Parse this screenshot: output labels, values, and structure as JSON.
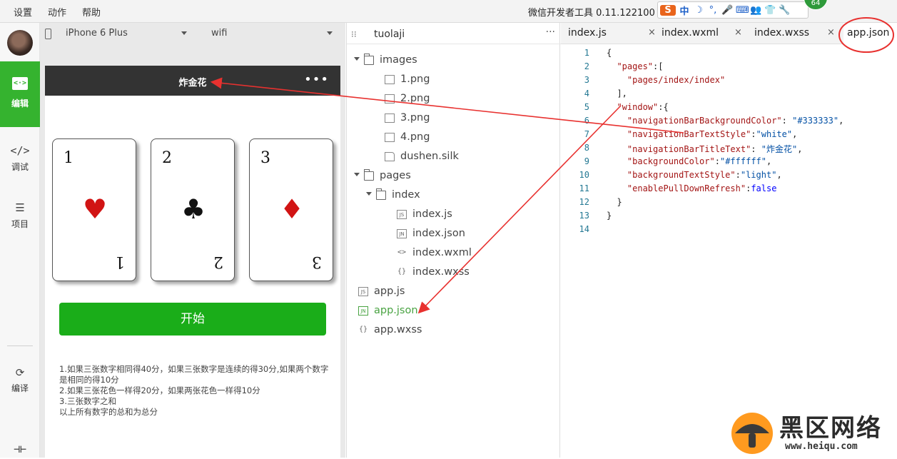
{
  "menubar": {
    "items": [
      "设置",
      "动作",
      "帮助"
    ],
    "app_title": "微信开发者工具 0.11.122100",
    "ime": {
      "logo": "S",
      "lang": "中",
      "badge": "64"
    }
  },
  "leftnav": {
    "items": [
      {
        "label": "编辑",
        "icon": "<·>"
      },
      {
        "label": "调试",
        "icon": "</>"
      },
      {
        "label": "项目",
        "icon": "☰"
      },
      {
        "label": "编译",
        "icon": "⟳"
      }
    ],
    "bottom_icon": "⊣⊢"
  },
  "simulator": {
    "device": "iPhone 6 Plus",
    "network": "wifi",
    "nav_title": "炸金花",
    "nav_more": "•••",
    "cards": [
      {
        "number": "1",
        "suit": "♥",
        "color": "#d11414"
      },
      {
        "number": "2",
        "suit": "♣",
        "color": "#111111"
      },
      {
        "number": "3",
        "suit": "♦",
        "color": "#d11414"
      }
    ],
    "start_button": "开始",
    "rules": [
      "1.如果三张数字相同得40分，如果三张数字是连续的得30分,如果两个数字是相同的得10分",
      "2.如果三张花色一样得20分，如果两张花色一样得10分",
      "3.三张数字之和",
      "以上所有数字的总和为总分"
    ]
  },
  "filetree": {
    "project": "tuolaji",
    "more": "···",
    "rows": [
      {
        "label": "images",
        "type": "folder",
        "icon": "folder-icon",
        "arrow": true
      },
      {
        "label": "1.png",
        "type": "image",
        "icon": "image-file-icon"
      },
      {
        "label": "2.png",
        "type": "image",
        "icon": "image-file-icon"
      },
      {
        "label": "3.png",
        "type": "image",
        "icon": "image-file-icon"
      },
      {
        "label": "4.png",
        "type": "image",
        "icon": "image-file-icon"
      },
      {
        "label": "dushen.silk",
        "type": "file",
        "icon": "file-icon"
      },
      {
        "label": "pages",
        "type": "folder",
        "icon": "folder-icon",
        "arrow": true
      },
      {
        "label": "index",
        "type": "folder",
        "icon": "folder-icon",
        "arrow": true
      },
      {
        "label": "index.js",
        "type": "js",
        "icon": "js-file-icon",
        "badge": "JS"
      },
      {
        "label": "index.json",
        "type": "json",
        "icon": "json-file-icon",
        "badge": "JN"
      },
      {
        "label": "index.wxml",
        "type": "wxml",
        "icon": "wxml-file-icon",
        "badge": "<>"
      },
      {
        "label": "index.wxss",
        "type": "wxss",
        "icon": "wxss-file-icon",
        "badge": "{}"
      },
      {
        "label": "app.js",
        "type": "js",
        "icon": "js-file-icon",
        "badge": "JS"
      },
      {
        "label": "app.json",
        "type": "json",
        "icon": "json-file-icon",
        "badge": "JN",
        "active": true
      },
      {
        "label": "app.wxss",
        "type": "wxss",
        "icon": "wxss-file-icon",
        "badge": "{}"
      }
    ]
  },
  "editor": {
    "tabs": [
      {
        "label": "index.js",
        "close": "×"
      },
      {
        "label": "index.wxml",
        "close": "×"
      },
      {
        "label": "index.wxss",
        "close": "×"
      },
      {
        "label": "app.json",
        "active": true
      }
    ],
    "line_numbers": [
      "1",
      "2",
      "3",
      "4",
      "5",
      "6",
      "7",
      "8",
      "9",
      "10",
      "11",
      "12",
      "13",
      "14"
    ],
    "code": [
      "{",
      "  \"pages\":[",
      "    \"pages/index/index\"",
      "  ],",
      "  \"window\":{",
      "    \"navigationBarBackgroundColor\": \"#333333\",",
      "    \"navigationBarTextStyle\":\"white\",",
      "    \"navigationBarTitleText\": \"炸金花\",",
      "    \"backgroundColor\":\"#ffffff\",",
      "    \"backgroundTextStyle\":\"light\",",
      "    \"enablePullDownRefresh\":false",
      "  }",
      "}",
      ""
    ]
  },
  "annotations": {
    "color": "#e8312f"
  },
  "watermark": {
    "text": "黑区网络",
    "url": "www.heiqu.com"
  },
  "colors": {
    "accent_green": "#35b32f",
    "button_green": "#1aad19",
    "navbar_dark": "#333333",
    "active_file": "#49a342"
  }
}
